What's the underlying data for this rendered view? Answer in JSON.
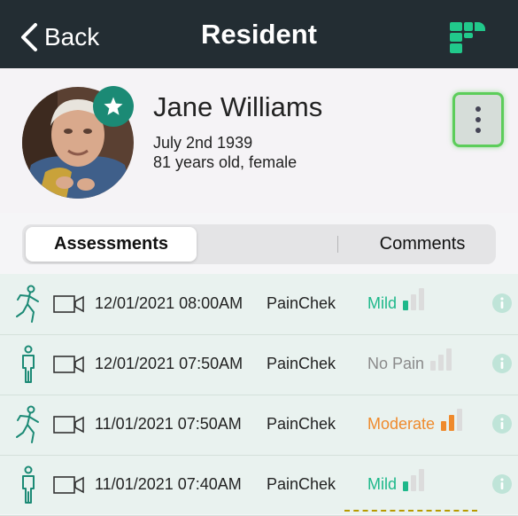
{
  "nav": {
    "back_label": "Back",
    "title": "Resident"
  },
  "resident": {
    "name": "Jane Williams",
    "dob": "July 2nd 1939",
    "age_gender": "81 years old, female"
  },
  "tabs": [
    {
      "label": "Assessments",
      "active": true
    },
    {
      "label": "Comments",
      "active": false
    }
  ],
  "assessments": [
    {
      "icon": "moving-person-icon",
      "datetime": "12/01/2021 08:00AM",
      "tool": "PainChek",
      "level": "Mild",
      "level_color": "#1db88a",
      "bars_filled": 1
    },
    {
      "icon": "standing-person-icon",
      "datetime": "12/01/2021 07:50AM",
      "tool": "PainChek",
      "level": "No Pain",
      "level_color": "#8a8a8a",
      "bars_filled": 0
    },
    {
      "icon": "moving-person-icon",
      "datetime": "11/01/2021 07:50AM",
      "tool": "PainChek",
      "level": "Moderate",
      "level_color": "#ef8a2c",
      "bars_filled": 2
    },
    {
      "icon": "standing-person-icon",
      "datetime": "11/01/2021 07:40AM",
      "tool": "PainChek",
      "level": "Mild",
      "level_color": "#1db88a",
      "bars_filled": 1
    }
  ],
  "colors": {
    "navbar": "#232d33",
    "accent": "#1b8a75",
    "mild": "#1db88a",
    "moderate": "#ef8a2c",
    "none": "#8a8a8a",
    "bar_empty": "#dcdcdc"
  }
}
